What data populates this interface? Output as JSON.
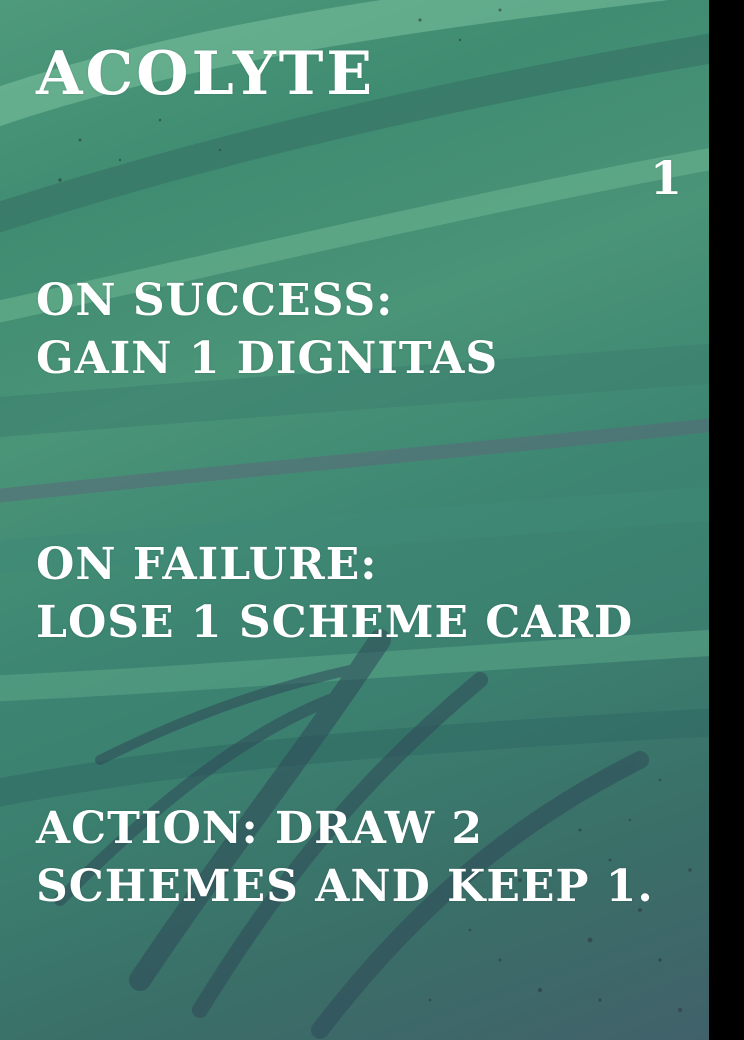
{
  "card": {
    "title": "Acolyte",
    "cost": "1",
    "success": {
      "heading": "On Success:",
      "effect": "Gain 1 Dignitas"
    },
    "failure": {
      "heading": "On Failure:",
      "effect": "Lose 1 Scheme Card"
    },
    "action": {
      "line1": "Action: Draw 2",
      "line2": "Schemes and Keep 1."
    }
  },
  "colors": {
    "background_top": "#4f9a7c",
    "background_bottom": "#41616a",
    "text": "#ffffff",
    "brush_dark": "#2f4f5a",
    "brush_light": "#6fb594",
    "splatter": "#2c3a3e",
    "side_bar": "#000000"
  }
}
